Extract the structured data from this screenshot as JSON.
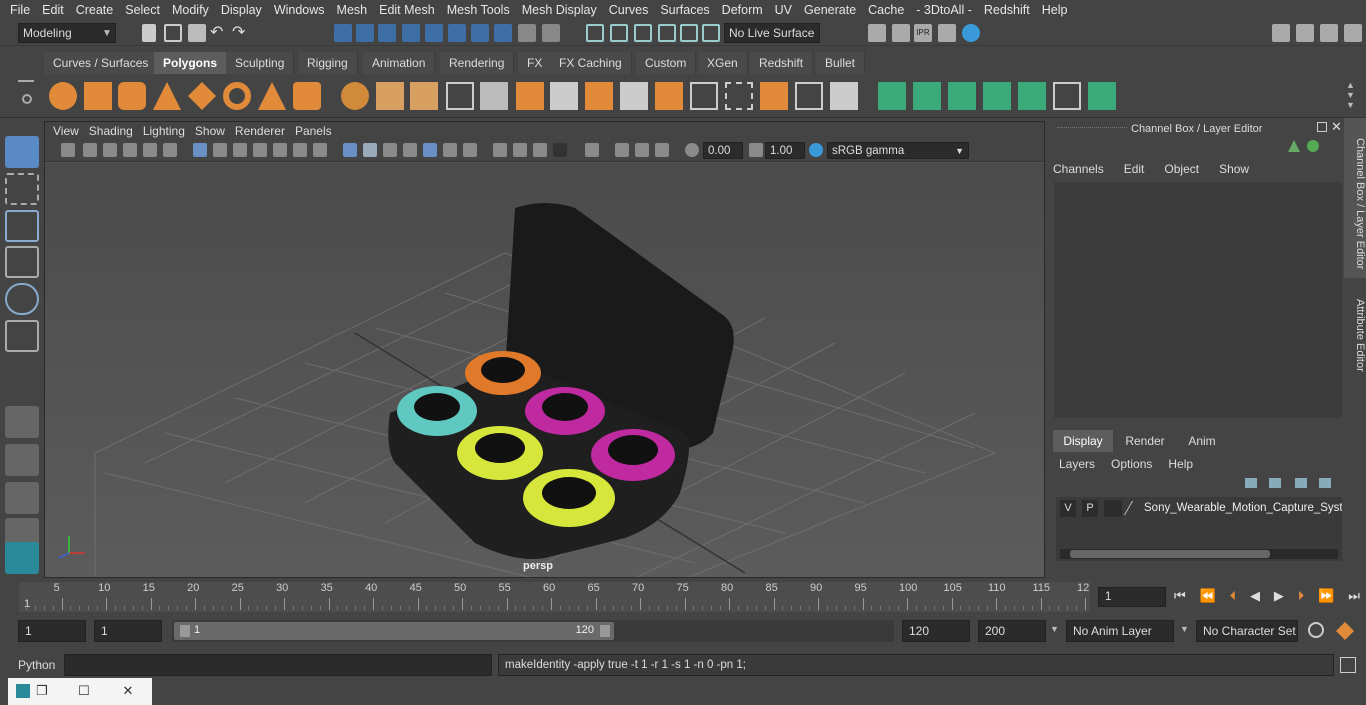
{
  "menus": [
    "File",
    "Edit",
    "Create",
    "Select",
    "Modify",
    "Display",
    "Windows",
    "Mesh",
    "Edit Mesh",
    "Mesh Tools",
    "Mesh Display",
    "Curves",
    "Surfaces",
    "Deform",
    "UV",
    "Generate",
    "Cache",
    "- 3DtoAll -",
    "Redshift",
    "Help"
  ],
  "status": {
    "workspace": "Modeling",
    "live_surface": "No Live Surface"
  },
  "shelf_tabs": [
    "Curves / Surfaces",
    "Polygons",
    "Sculpting",
    "Rigging",
    "Animation",
    "Rendering",
    "FX",
    "FX Caching",
    "Custom",
    "XGen",
    "Redshift",
    "Bullet"
  ],
  "shelf_active": "Polygons",
  "viewport": {
    "menu": [
      "View",
      "Shading",
      "Lighting",
      "Show",
      "Renderer",
      "Panels"
    ],
    "exposure": "0.00",
    "gamma": "1.00",
    "colorspace": "sRGB gamma",
    "camera_label": "persp"
  },
  "channel_box": {
    "title": "Channel Box / Layer Editor",
    "menu": [
      "Channels",
      "Edit",
      "Object",
      "Show"
    ],
    "layer_tabs": [
      "Display",
      "Render",
      "Anim"
    ],
    "layer_menu": [
      "Layers",
      "Options",
      "Help"
    ],
    "layer": {
      "v": "V",
      "p": "P",
      "name": "Sony_Wearable_Motion_Capture_Syst"
    }
  },
  "side_tabs": {
    "channel": "Channel Box / Layer Editor",
    "attribute": "Attribute Editor"
  },
  "timeline": {
    "ticks": [
      "5",
      "10",
      "15",
      "20",
      "25",
      "30",
      "35",
      "40",
      "45",
      "50",
      "55",
      "60",
      "65",
      "70",
      "75",
      "80",
      "85",
      "90",
      "95",
      "100",
      "105",
      "110",
      "115",
      "12"
    ],
    "start_marker": "1",
    "current_frame": "1"
  },
  "range": {
    "start": "1",
    "playback_start": "1",
    "slider_start": "1",
    "slider_end": "120",
    "playback_end": "120",
    "end": "200",
    "anim_layer": "No Anim Layer",
    "char_set": "No Character Set"
  },
  "cmd": {
    "lang": "Python",
    "output": "makeIdentity -apply true -t 1 -r 1 -s 1 -n 0 -pn 1;"
  },
  "colors": {
    "accent": "#5a8ac6",
    "active_tab": "#5d5d5d",
    "orange": "#e07a2a",
    "teal": "#3aa0a0"
  }
}
